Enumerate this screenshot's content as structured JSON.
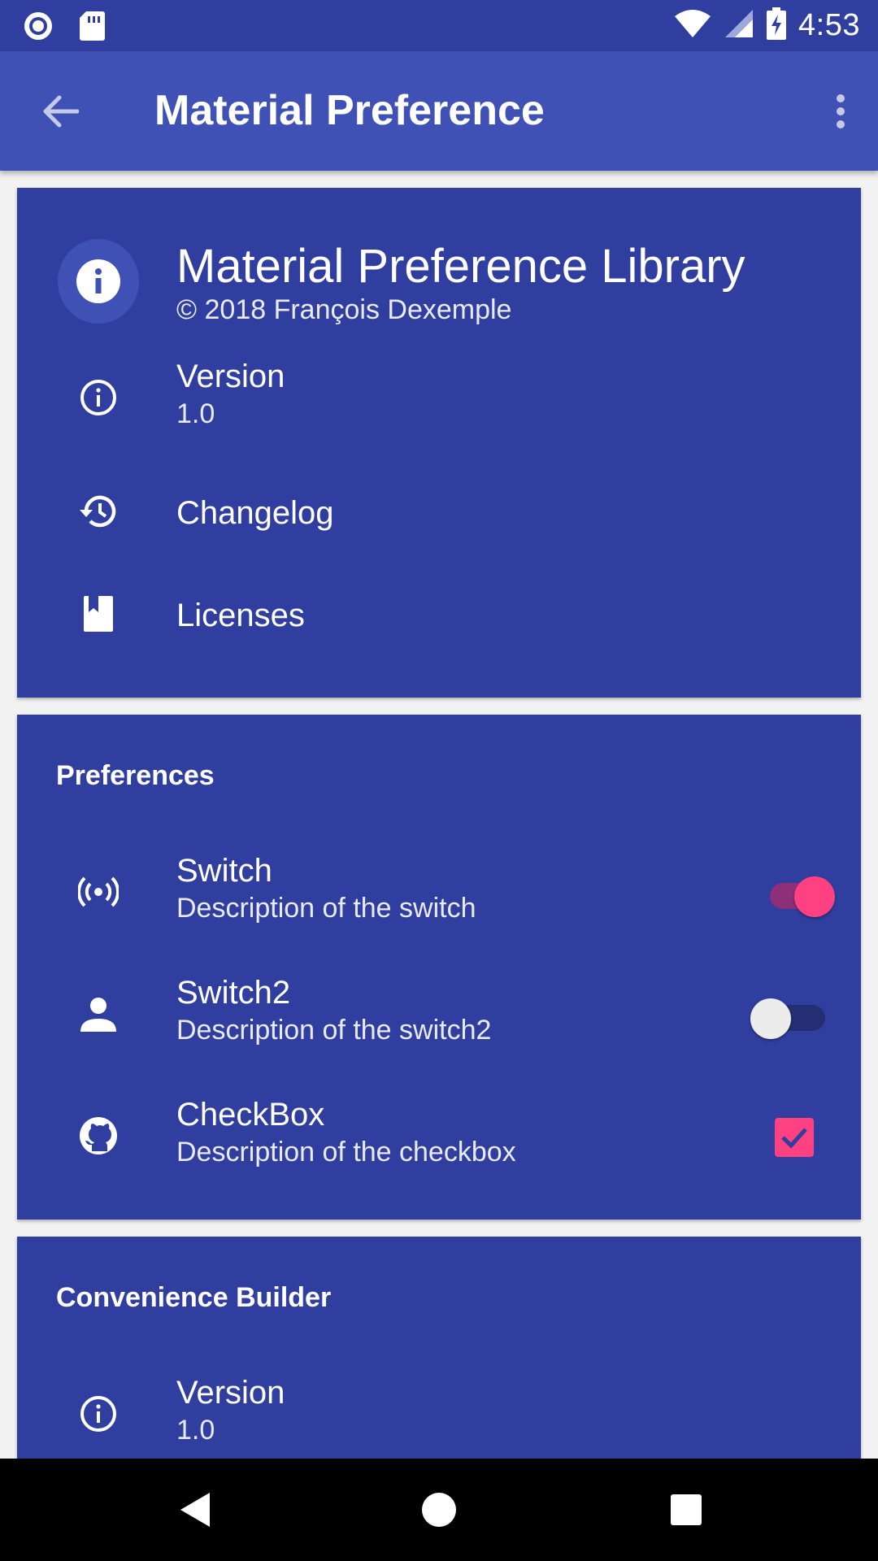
{
  "status_bar": {
    "time": "4:53"
  },
  "app_bar": {
    "title": "Material Preference"
  },
  "about_card": {
    "title": "Material Preference Library",
    "copyright": "© 2018 François Dexemple",
    "items": [
      {
        "title": "Version",
        "subtitle": "1.0",
        "icon": "info-outline-icon"
      },
      {
        "title": "Changelog",
        "icon": "history-icon"
      },
      {
        "title": "Licenses",
        "icon": "book-icon"
      }
    ]
  },
  "preferences_card": {
    "header": "Preferences",
    "items": [
      {
        "title": "Switch",
        "subtitle": "Description of the switch",
        "icon": "wifi-tethering-icon",
        "control": "switch",
        "checked": true
      },
      {
        "title": "Switch2",
        "subtitle": "Description of the switch2",
        "icon": "person-icon",
        "control": "switch",
        "checked": false
      },
      {
        "title": "CheckBox",
        "subtitle": "Description of the checkbox",
        "icon": "github-icon",
        "control": "checkbox",
        "checked": true
      }
    ]
  },
  "builder_card": {
    "header": "Convenience Builder",
    "items": [
      {
        "title": "Version",
        "subtitle": "1.0",
        "icon": "info-outline-icon"
      }
    ]
  },
  "colors": {
    "primary": "#3f51b5",
    "primary_dark": "#303f9f",
    "accent": "#ff4081",
    "card_background": "#303f9f"
  }
}
